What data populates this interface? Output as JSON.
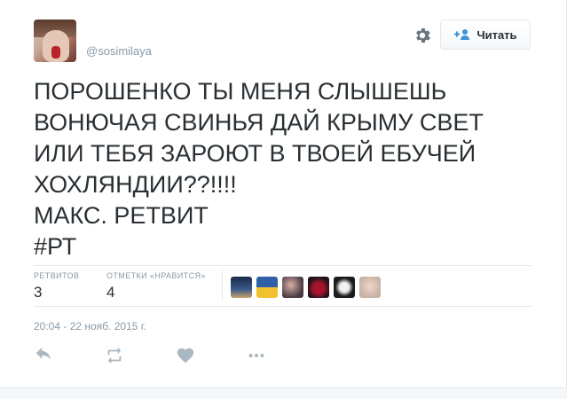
{
  "user": {
    "handle": "@sosimilaya"
  },
  "header": {
    "follow_label": "Читать",
    "icons": [
      "gear-icon",
      "follow-person-plus-icon"
    ]
  },
  "tweet": {
    "lines": [
      "ПОРОШЕНКО ТЫ МЕНЯ СЛЫШЕШЬ",
      "ВОНЮЧАЯ СВИНЬЯ ДАЙ КРЫМУ СВЕТ",
      "ИЛИ ТЕБЯ ЗАРОЮТ В ТВОЕЙ ЕБУЧЕЙ",
      "ХОХЛЯНДИИ??!!!!",
      "МАКС. РЕТВИТ",
      "#РТ"
    ]
  },
  "stats": {
    "retweets_label": "РЕТВИТОВ",
    "retweets_count": "3",
    "likes_label": "ОТМЕТКИ «НРАВИТСЯ»",
    "likes_count": "4"
  },
  "favoriters": [
    "avatar-1",
    "avatar-2",
    "avatar-3",
    "avatar-4",
    "avatar-5",
    "avatar-6"
  ],
  "timestamp": "20:04 - 22 нояб. 2015 г.",
  "actions": [
    "reply-icon",
    "retweet-icon",
    "like-heart-icon",
    "more-dots-icon"
  ],
  "colors": {
    "text": "#292f33",
    "muted": "#8899a6",
    "border": "#e1e8ed",
    "icon": "#aab8c2",
    "link_blue": "#3b94d9"
  }
}
